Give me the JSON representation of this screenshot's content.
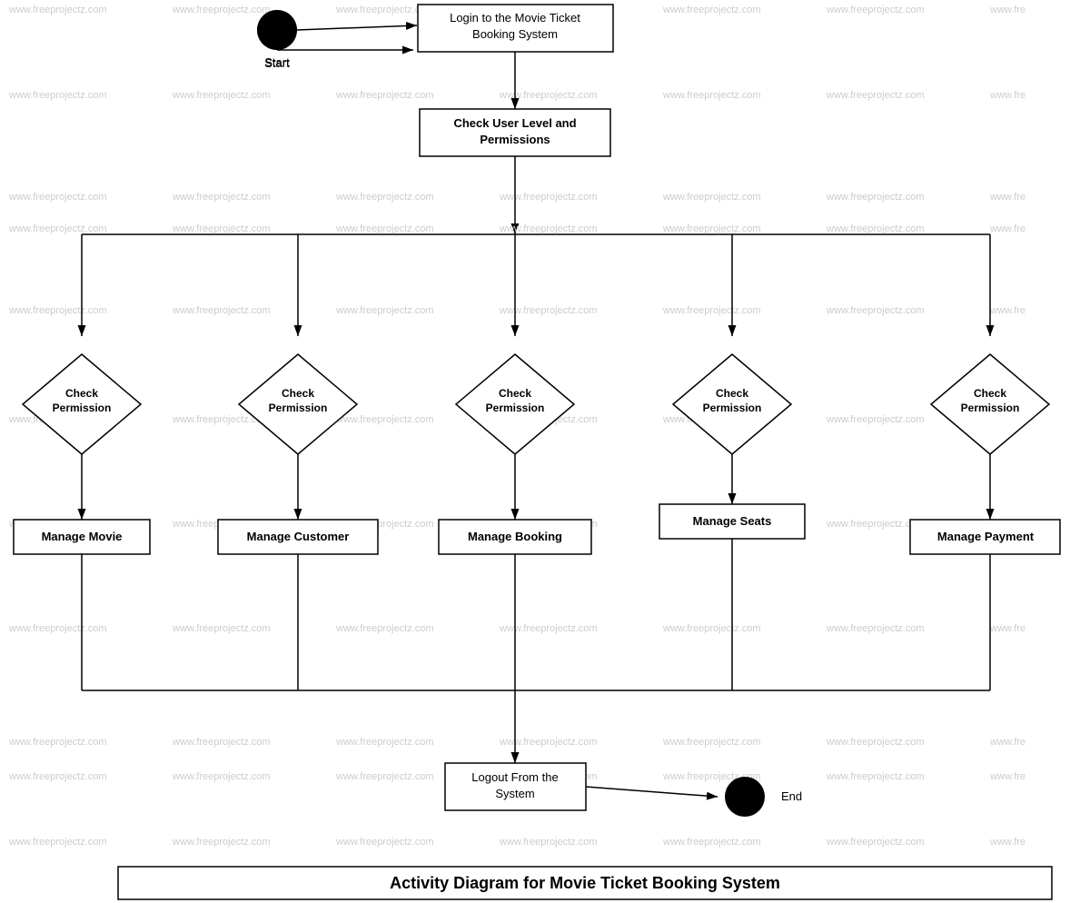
{
  "watermark": "www.freeprojectz.com",
  "title": "Activity Diagram for Movie Ticket Booking System",
  "nodes": {
    "start_label": "Start",
    "end_label": "End",
    "login": "Login to the Movie Ticket\nBooking System",
    "check_user_level": "Check User Level and\nPermissions",
    "check_permission_1": "Check\nPermission",
    "check_permission_2": "Check\nPermission",
    "check_permission_3": "Check\nPermission",
    "check_permission_4": "Check\nPermission",
    "check_permission_5": "Check\nPermission",
    "manage_movie": "Manage Movie",
    "manage_customer": "Manage Customer",
    "manage_booking": "Manage Booking",
    "manage_seats": "Manage Seats",
    "manage_payment": "Manage Payment",
    "logout": "Logout From the\nSystem"
  },
  "colors": {
    "box_border": "#000000",
    "diamond_border": "#000000",
    "arrow": "#000000",
    "watermark": "#cccccc",
    "background": "#ffffff"
  }
}
